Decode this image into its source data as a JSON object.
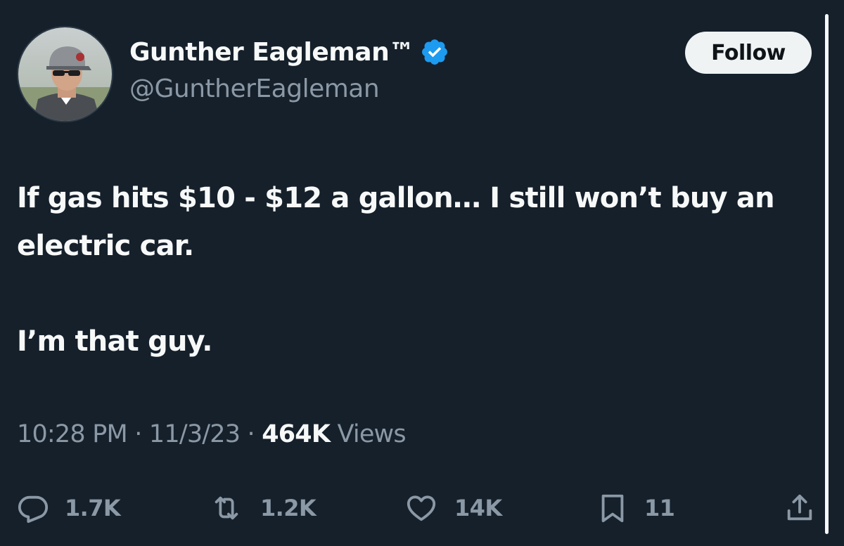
{
  "user": {
    "display_name": "Gunther Eagleman™",
    "handle": "@GuntherEagleman",
    "verified_icon": "verified-badge-icon",
    "avatar": "avatar"
  },
  "follow": {
    "label": "Follow"
  },
  "tweet": {
    "lines": [
      "If gas hits $10 - $12 a gallon… I still won’t buy an electric car.",
      "",
      "I’m that guy."
    ]
  },
  "meta": {
    "time": "10:28 PM",
    "sep1": "·",
    "date": "11/3/23",
    "sep2": "·",
    "views_count": "464K",
    "views_label": "Views"
  },
  "actions": {
    "replies": {
      "icon": "reply-icon",
      "count": "1.7K"
    },
    "retweets": {
      "icon": "retweet-icon",
      "count": "1.2K"
    },
    "likes": {
      "icon": "heart-icon",
      "count": "14K"
    },
    "bookmarks": {
      "icon": "bookmark-icon",
      "count": "11"
    },
    "share": {
      "icon": "share-icon"
    }
  },
  "colors": {
    "background": "#15202b",
    "primary_text": "#f7f9f9",
    "secondary_text": "#8b98a5",
    "verified": "#1d9bf0",
    "follow_bg": "#eff3f4"
  }
}
